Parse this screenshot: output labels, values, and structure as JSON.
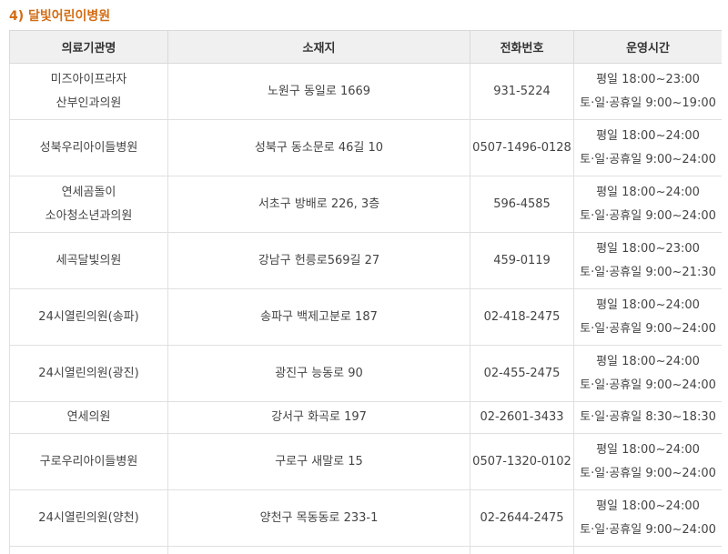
{
  "section": {
    "title": "4) 달빛어린이병원"
  },
  "table": {
    "headers": [
      "의료기관명",
      "소재지",
      "전화번호",
      "운영시간"
    ],
    "rows": [
      {
        "name": [
          "미즈아이프라자",
          "산부인과의원"
        ],
        "address": "노원구 동일로 1669",
        "phone": "931-5224",
        "hours": [
          "평일 18:00~23:00",
          "토·일·공휴일 9:00~19:00"
        ]
      },
      {
        "name": [
          "성북우리아이들병원"
        ],
        "address": "성북구 동소문로 46길 10",
        "phone": "0507-1496-0128",
        "hours": [
          "평일 18:00~24:00",
          "토·일·공휴일 9:00~24:00"
        ]
      },
      {
        "name": [
          "연세곰돌이",
          "소아청소년과의원"
        ],
        "address": "서초구 방배로 226, 3층",
        "phone": "596-4585",
        "hours": [
          "평일 18:00~24:00",
          "토·일·공휴일 9:00~24:00"
        ]
      },
      {
        "name": [
          "세곡달빛의원"
        ],
        "address": "강남구 헌릉로569길 27",
        "phone": "459-0119",
        "hours": [
          "평일 18:00~23:00",
          "토·일·공휴일 9:00~21:30"
        ]
      },
      {
        "name": [
          "24시열린의원(송파)"
        ],
        "address": "송파구 백제고분로 187",
        "phone": "02-418-2475",
        "hours": [
          "평일 18:00~24:00",
          "토·일·공휴일 9:00~24:00"
        ]
      },
      {
        "name": [
          "24시열린의원(광진)"
        ],
        "address": "광진구 능동로 90",
        "phone": "02-455-2475",
        "hours": [
          "평일 18:00~24:00",
          "토·일·공휴일 9:00~24:00"
        ]
      },
      {
        "name": [
          "연세의원"
        ],
        "address": "강서구 화곡로 197",
        "phone": "02-2601-3433",
        "hours": [
          "토·일·공휴일 8:30~18:30"
        ]
      },
      {
        "name": [
          "구로우리아이들병원"
        ],
        "address": "구로구 새말로 15",
        "phone": "0507-1320-0102",
        "hours": [
          "평일 18:00~24:00",
          "토·일·공휴일 9:00~24:00"
        ]
      },
      {
        "name": [
          "24시열린의원(양천)"
        ],
        "address": "양천구 목동동로 233-1",
        "phone": "02-2644-2475",
        "hours": [
          "평일 18:00~24:00",
          "토·일·공휴일 9:00~24:00"
        ]
      }
    ]
  }
}
